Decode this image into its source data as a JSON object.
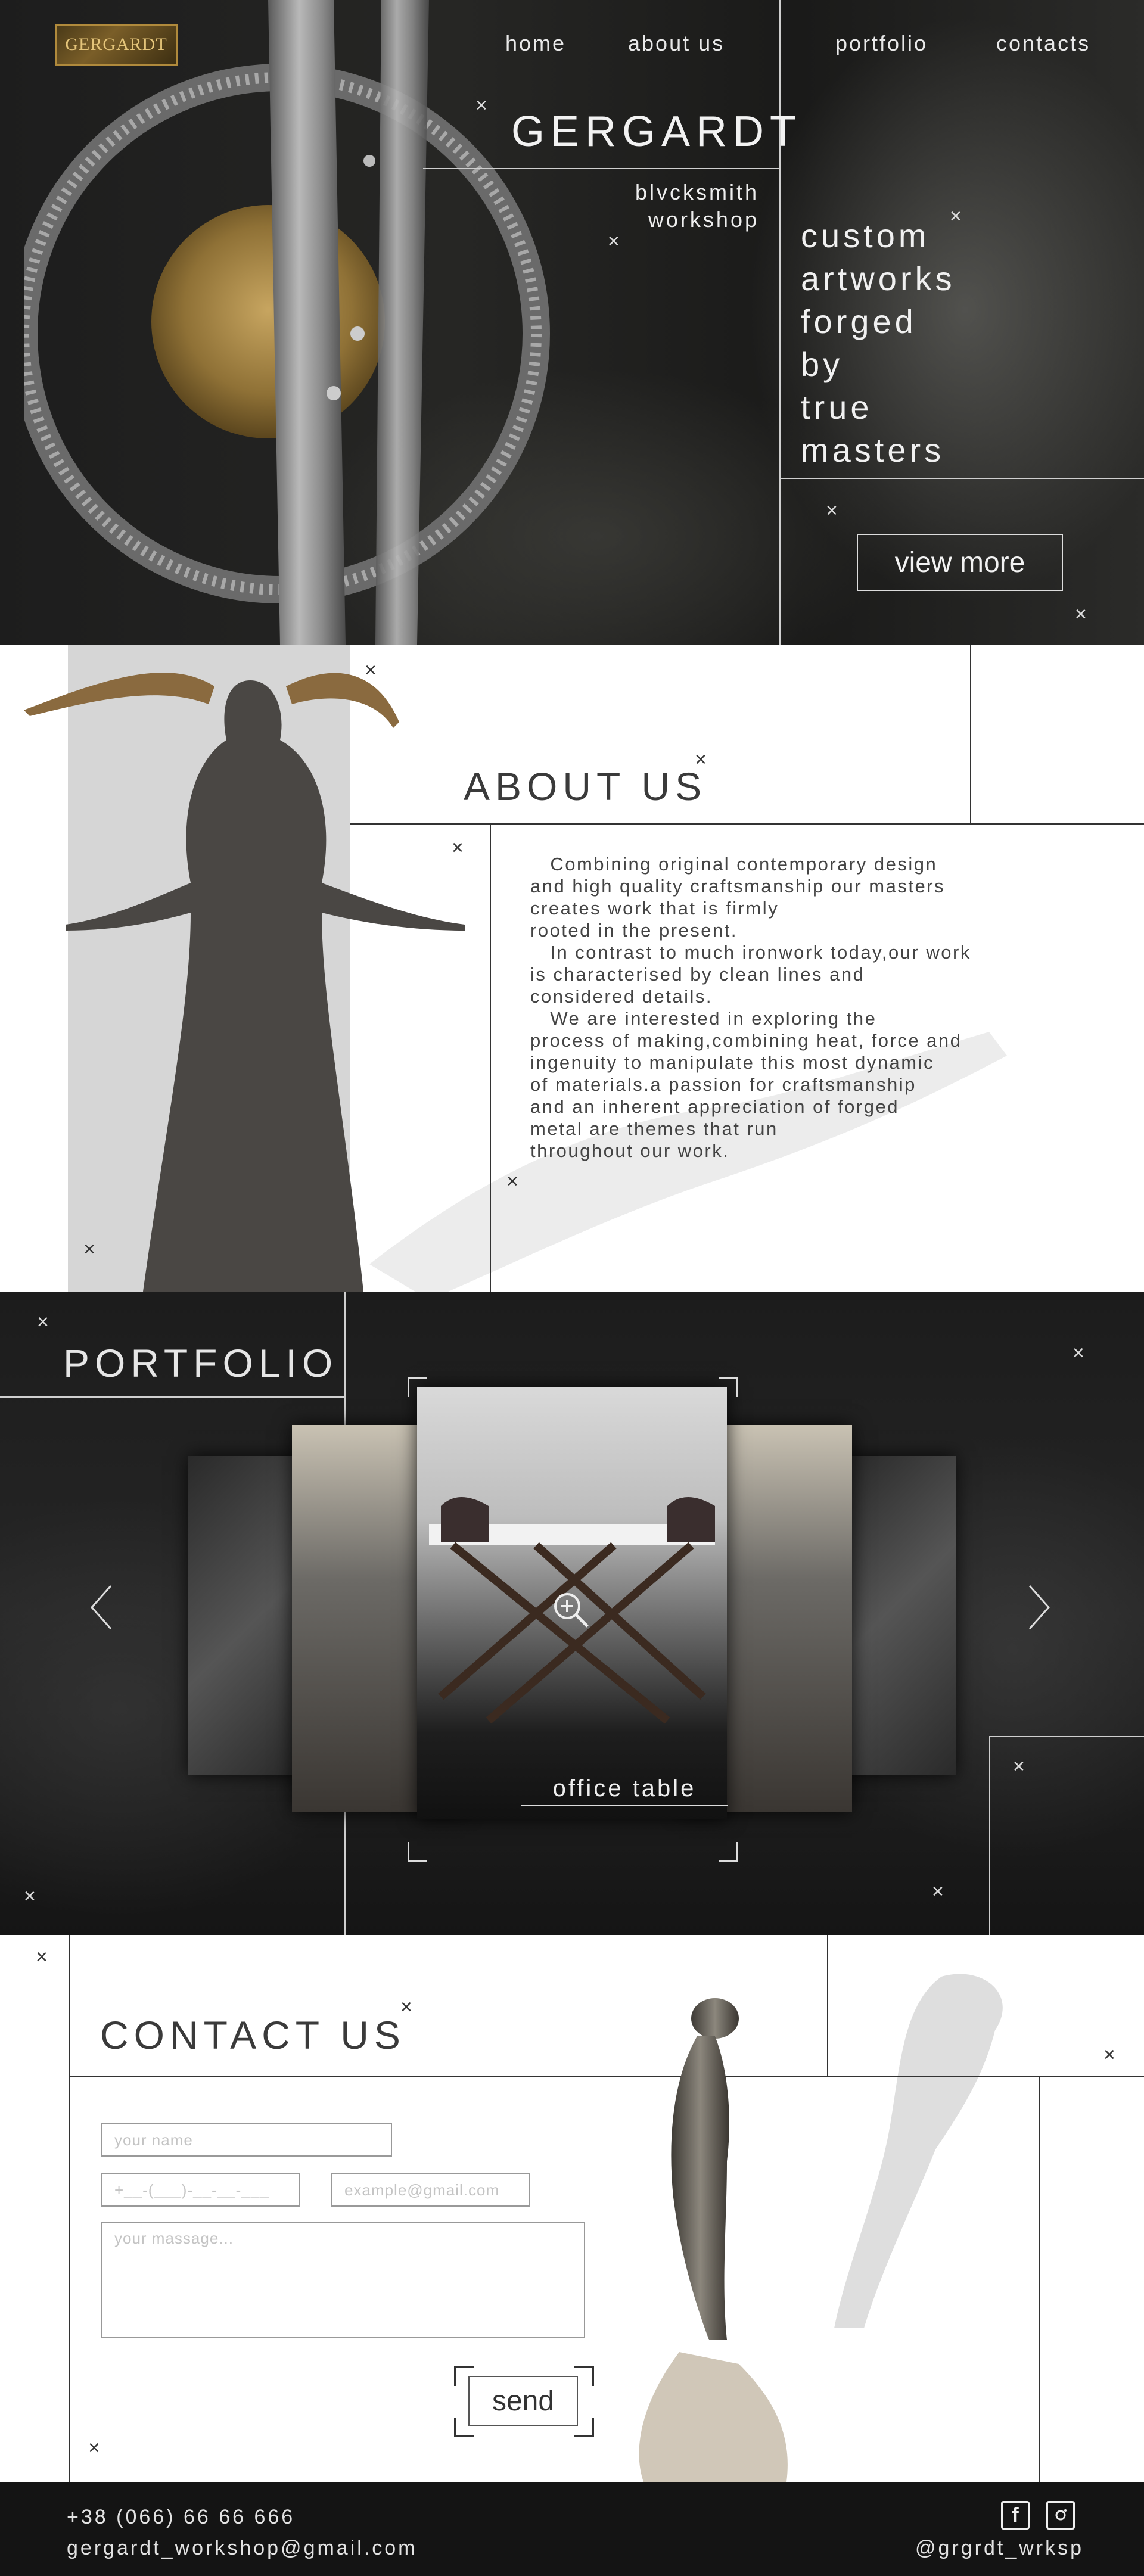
{
  "colors": {
    "dark_bg": "#141414",
    "light_bg": "#ffffff",
    "accent_gold": "#b08a3c",
    "panel_grey": "#d6d6d6"
  },
  "header": {
    "logo_text": "GERGARDT",
    "nav": [
      {
        "label": "home"
      },
      {
        "label": "about us"
      },
      {
        "label": "portfolio"
      },
      {
        "label": "contacts"
      }
    ]
  },
  "hero": {
    "brand": "GERGARDT",
    "subtitle_line1": "blvcksmith",
    "subtitle_line2": "workshop",
    "tagline": [
      "custom",
      "artworks",
      "forged",
      "by",
      "true",
      "masters"
    ],
    "cta_label": "view more"
  },
  "about": {
    "title": "ABOUT US",
    "lines": [
      "   Combining original contemporary design",
      "and high quality craftsmanship our masters",
      "creates work that is firmly",
      "rooted in the present.",
      "   In contrast to much ironwork today,our work",
      "is characterised by clean lines and",
      "considered details.",
      "   We are interested in exploring the",
      "process of making,combining heat, force and",
      "ingenuity to manipulate this most dynamic",
      "of materials.a passion for craftsmanship",
      "and an inherent appreciation of forged",
      "metal are themes that run",
      "throughout our work."
    ]
  },
  "portfolio": {
    "title": "PORTFOLIO",
    "caption": "office table",
    "zoom_icon": "zoom-in-icon",
    "prev_icon": "chevron-left-icon",
    "next_icon": "chevron-right-icon"
  },
  "contact": {
    "title": "CONTACT US",
    "name_placeholder": "your name",
    "phone_placeholder": "+__-(___)-__-__-___",
    "email_placeholder": "example@gmail.com",
    "message_placeholder": "your massage...",
    "send_label": "send"
  },
  "footer": {
    "phone": "+38 (066) 66 66 666",
    "email": "gergardt_workshop@gmail.com",
    "social_handle": "@grgrdt_wrksp",
    "icons": [
      "facebook-icon",
      "instagram-icon"
    ]
  }
}
